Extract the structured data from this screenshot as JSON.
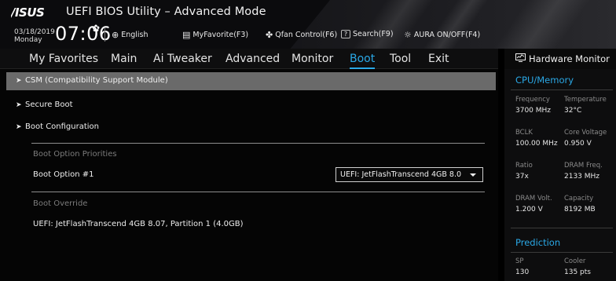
{
  "header": {
    "logo_text": "ASUS",
    "title": "UEFI BIOS Utility – Advanced Mode",
    "date": "03/18/2019",
    "day": "Monday",
    "time": "07:06",
    "buttons": [
      {
        "label": "English",
        "icon": "globe-icon"
      },
      {
        "label": "MyFavorite(F3)",
        "icon": "favorite-icon"
      },
      {
        "label": "Qfan Control(F6)",
        "icon": "fan-icon"
      },
      {
        "label": "Search(F9)",
        "icon": "question-icon",
        "key": "?"
      },
      {
        "label": "AURA ON/OFF(F4)",
        "icon": "aura-icon"
      }
    ]
  },
  "tabs": [
    {
      "label": "My Favorites",
      "active": false
    },
    {
      "label": "Main",
      "active": false
    },
    {
      "label": "Ai Tweaker",
      "active": false
    },
    {
      "label": "Advanced",
      "active": false
    },
    {
      "label": "Monitor",
      "active": false
    },
    {
      "label": "Boot",
      "active": true
    },
    {
      "label": "Tool",
      "active": false
    },
    {
      "label": "Exit",
      "active": false
    }
  ],
  "main": {
    "submenus": [
      {
        "label": "CSM (Compatibility Support Module)",
        "highlighted": true
      },
      {
        "label": "Secure Boot",
        "highlighted": false
      },
      {
        "label": "Boot Configuration",
        "highlighted": false
      }
    ],
    "boot_priorities": {
      "section_label": "Boot Option Priorities",
      "option_label": "Boot Option #1",
      "option_value": "UEFI: JetFlashTranscend 4GB 8.0"
    },
    "boot_override": {
      "section_label": "Boot Override",
      "item": "UEFI: JetFlashTranscend 4GB 8.07, Partition 1 (4.0GB)"
    }
  },
  "hardware_monitor": {
    "title": "Hardware Monitor",
    "sections": [
      {
        "title": "CPU/Memory",
        "rows": [
          [
            {
              "k": "Frequency",
              "v": "3700 MHz"
            },
            {
              "k": "Temperature",
              "v": "32°C"
            }
          ],
          [
            {
              "k": "BCLK",
              "v": "100.00 MHz"
            },
            {
              "k": "Core Voltage",
              "v": "0.950 V"
            }
          ],
          [
            {
              "k": "Ratio",
              "v": "37x"
            },
            {
              "k": "DRAM Freq.",
              "v": "2133 MHz"
            }
          ],
          [
            {
              "k": "DRAM Volt.",
              "v": "1.200 V"
            },
            {
              "k": "Capacity",
              "v": "8192 MB"
            }
          ]
        ]
      },
      {
        "title": "Prediction",
        "rows": [
          [
            {
              "k": "SP",
              "v": "130"
            },
            {
              "k": "Cooler",
              "v": "135 pts"
            }
          ]
        ]
      }
    ]
  },
  "colors": {
    "accent": "#2aa8e6",
    "highlight_row": "#6a6a6a",
    "background": "#050505"
  }
}
